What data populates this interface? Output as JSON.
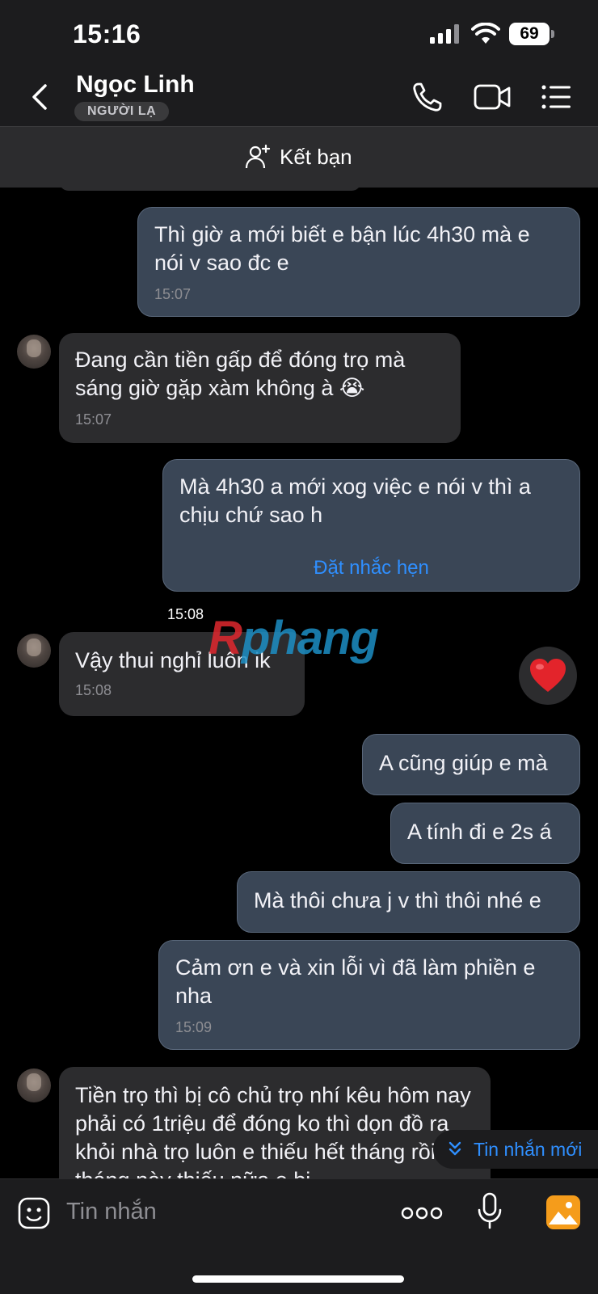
{
  "status_bar": {
    "time": "15:16",
    "battery": "69"
  },
  "header": {
    "title": "Ngọc Linh",
    "badge": "NGƯỜI LẠ"
  },
  "friend_bar": {
    "label": "Kết bạn"
  },
  "messages": [
    {
      "side": "me",
      "text": "Thì giờ a mới biết e bận lúc 4h30 mà e nói v sao đc e",
      "time": "15:07"
    },
    {
      "side": "them",
      "text": "Đang cần tiền gấp để đóng trọ mà sáng giờ gặp xàm không à 😭",
      "time": "15:07"
    },
    {
      "side": "me",
      "text": "Mà 4h30 a mới xog việc e nói v thì a chịu chứ sao h",
      "action": "Đặt nhắc hẹn",
      "time": "15:08"
    },
    {
      "side": "them",
      "text": "Vậy thui nghỉ luôn ik",
      "time": "15:08",
      "reaction": "heart"
    },
    {
      "side": "me",
      "text": "A cũng giúp e mà"
    },
    {
      "side": "me",
      "text": "A tính đi e 2s á"
    },
    {
      "side": "me",
      "text": "Mà thôi chưa j v thì thôi nhé e"
    },
    {
      "side": "me",
      "text": "Cảm ơn e và xin lỗi vì đã làm phiền e nha",
      "time": "15:09"
    },
    {
      "side": "them",
      "text": "Tiền trọ thì bị cô chủ trọ nhí kêu hôm nay phải có 1triệu để đóng ko thì dọn đồ ra khỏi nhà trọ luôn e thiếu hết tháng rồi đó tháng này thiếu nữa e bị"
    }
  ],
  "new_message_pill": {
    "label": "Tin nhắn mới"
  },
  "input": {
    "placeholder": "Tin nhắn"
  },
  "watermark": {
    "part1": "R",
    "part2": "phang"
  },
  "colors": {
    "accent": "#2f8fff",
    "my_bubble": "#3a4656",
    "their_bubble": "#2c2c2e",
    "heart": "#e3242b"
  }
}
